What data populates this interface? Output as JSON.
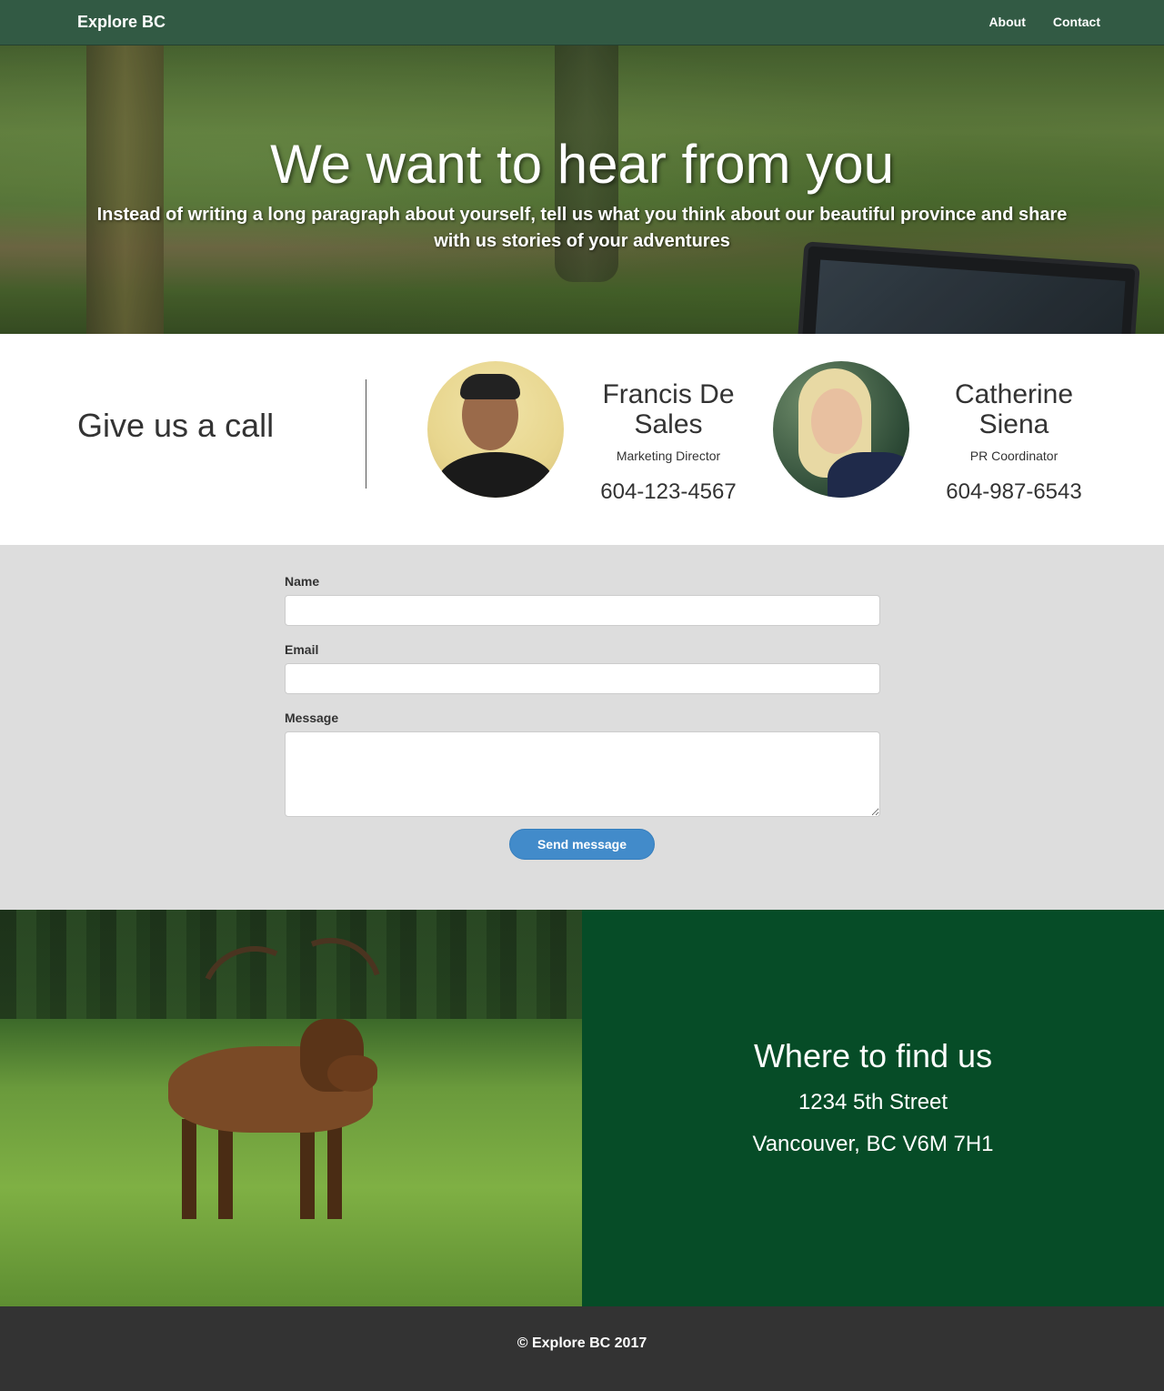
{
  "nav": {
    "brand": "Explore BC",
    "links": [
      "About",
      "Contact"
    ]
  },
  "hero": {
    "title": "We want to hear from you",
    "subtitle": "Instead of writing a long paragraph about yourself, tell us what you think about our beautiful province and share with us stories of your adventures"
  },
  "contacts": {
    "heading": "Give us a call",
    "people": [
      {
        "name": "Francis De Sales",
        "role": "Marketing Director",
        "phone": "604-123-4567"
      },
      {
        "name": "Catherine Siena",
        "role": "PR Coordinator",
        "phone": "604-987-6543"
      }
    ]
  },
  "form": {
    "name_label": "Name",
    "name_value": "",
    "email_label": "Email",
    "email_value": "",
    "message_label": "Message",
    "message_value": "",
    "submit_label": "Send message"
  },
  "location": {
    "title": "Where to find us",
    "line1": "1234 5th Street",
    "line2": "Vancouver, BC V6M 7H1"
  },
  "footer": {
    "text": "© Explore BC 2017"
  },
  "colors": {
    "navbar": "#325a44",
    "location_bg": "#064c27",
    "form_bg": "#dddddd",
    "button": "#428bca",
    "footer": "#333333"
  }
}
